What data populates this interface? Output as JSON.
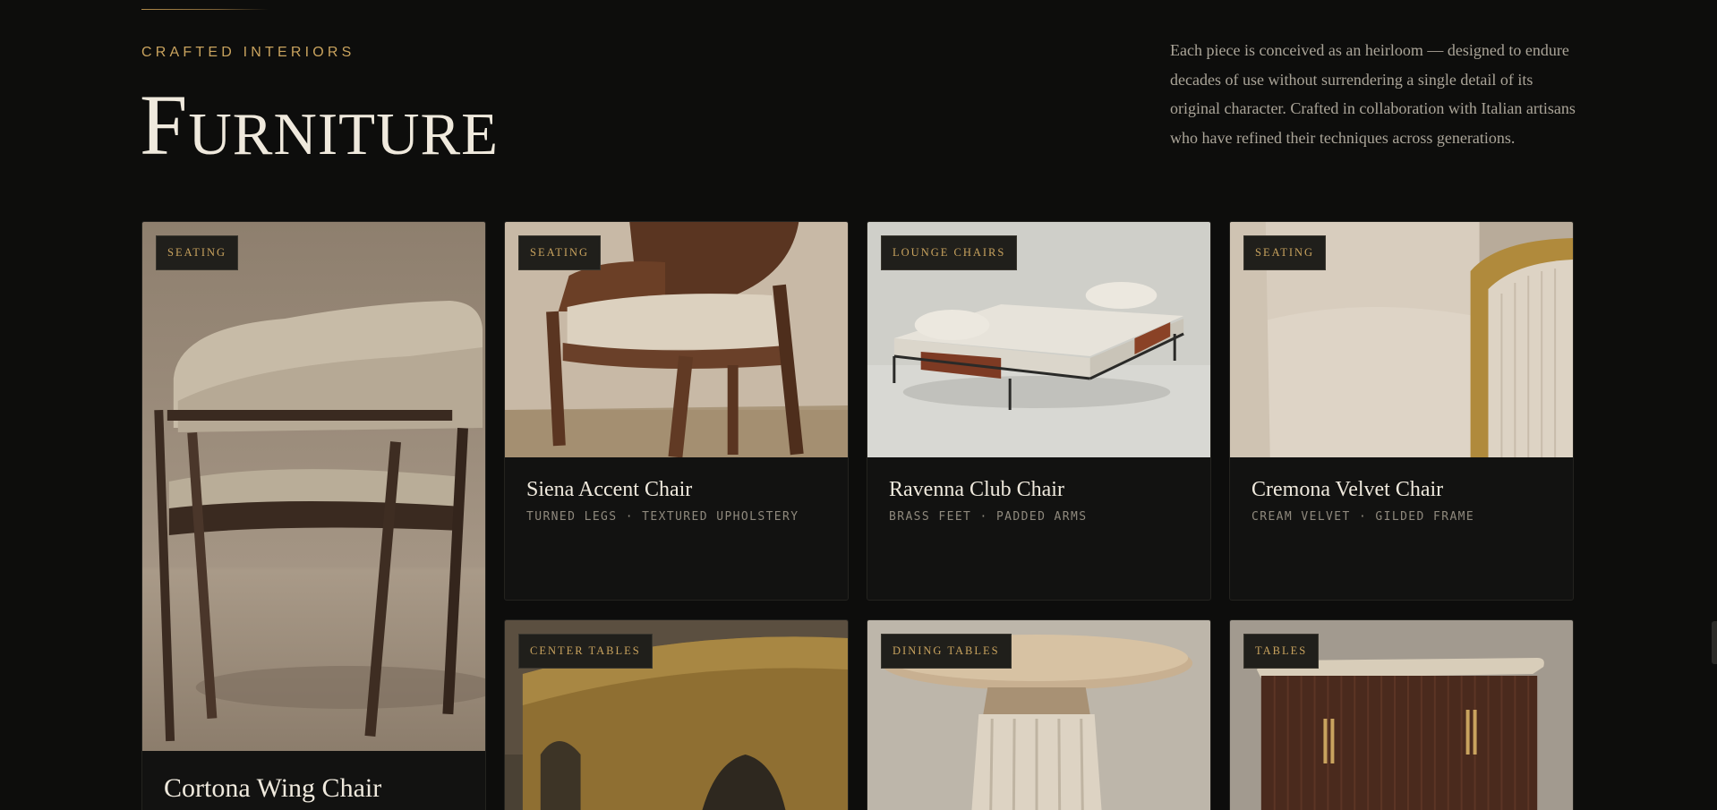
{
  "header": {
    "eyebrow": "CRAFTED INTERIORS",
    "title": "Furniture",
    "intro": "Each piece is conceived as an heirloom — designed to endure decades of use without surrendering a single detail of its original character. Crafted in collaboration with Italian artisans who have refined their techniques across generations."
  },
  "products": [
    {
      "category": "SEATING",
      "name": "Cortona Wing Chair",
      "details": ""
    },
    {
      "category": "SEATING",
      "name": "Siena Accent Chair",
      "details": "TURNED LEGS · TEXTURED UPHOLSTERY"
    },
    {
      "category": "LOUNGE CHAIRS",
      "name": "Ravenna Club Chair",
      "details": "BRASS FEET · PADDED ARMS"
    },
    {
      "category": "SEATING",
      "name": "Cremona Velvet Chair",
      "details": "CREAM VELVET · GILDED FRAME"
    },
    {
      "category": "CENTER TABLES",
      "name": "",
      "details": ""
    },
    {
      "category": "DINING TABLES",
      "name": "",
      "details": ""
    },
    {
      "category": "TABLES",
      "name": "",
      "details": ""
    }
  ],
  "theme": {
    "background": "#0d0d0c",
    "accent": "#c9a35e",
    "card_background": "#121211",
    "text": "#efe9dd",
    "muted": "#8f897d"
  }
}
